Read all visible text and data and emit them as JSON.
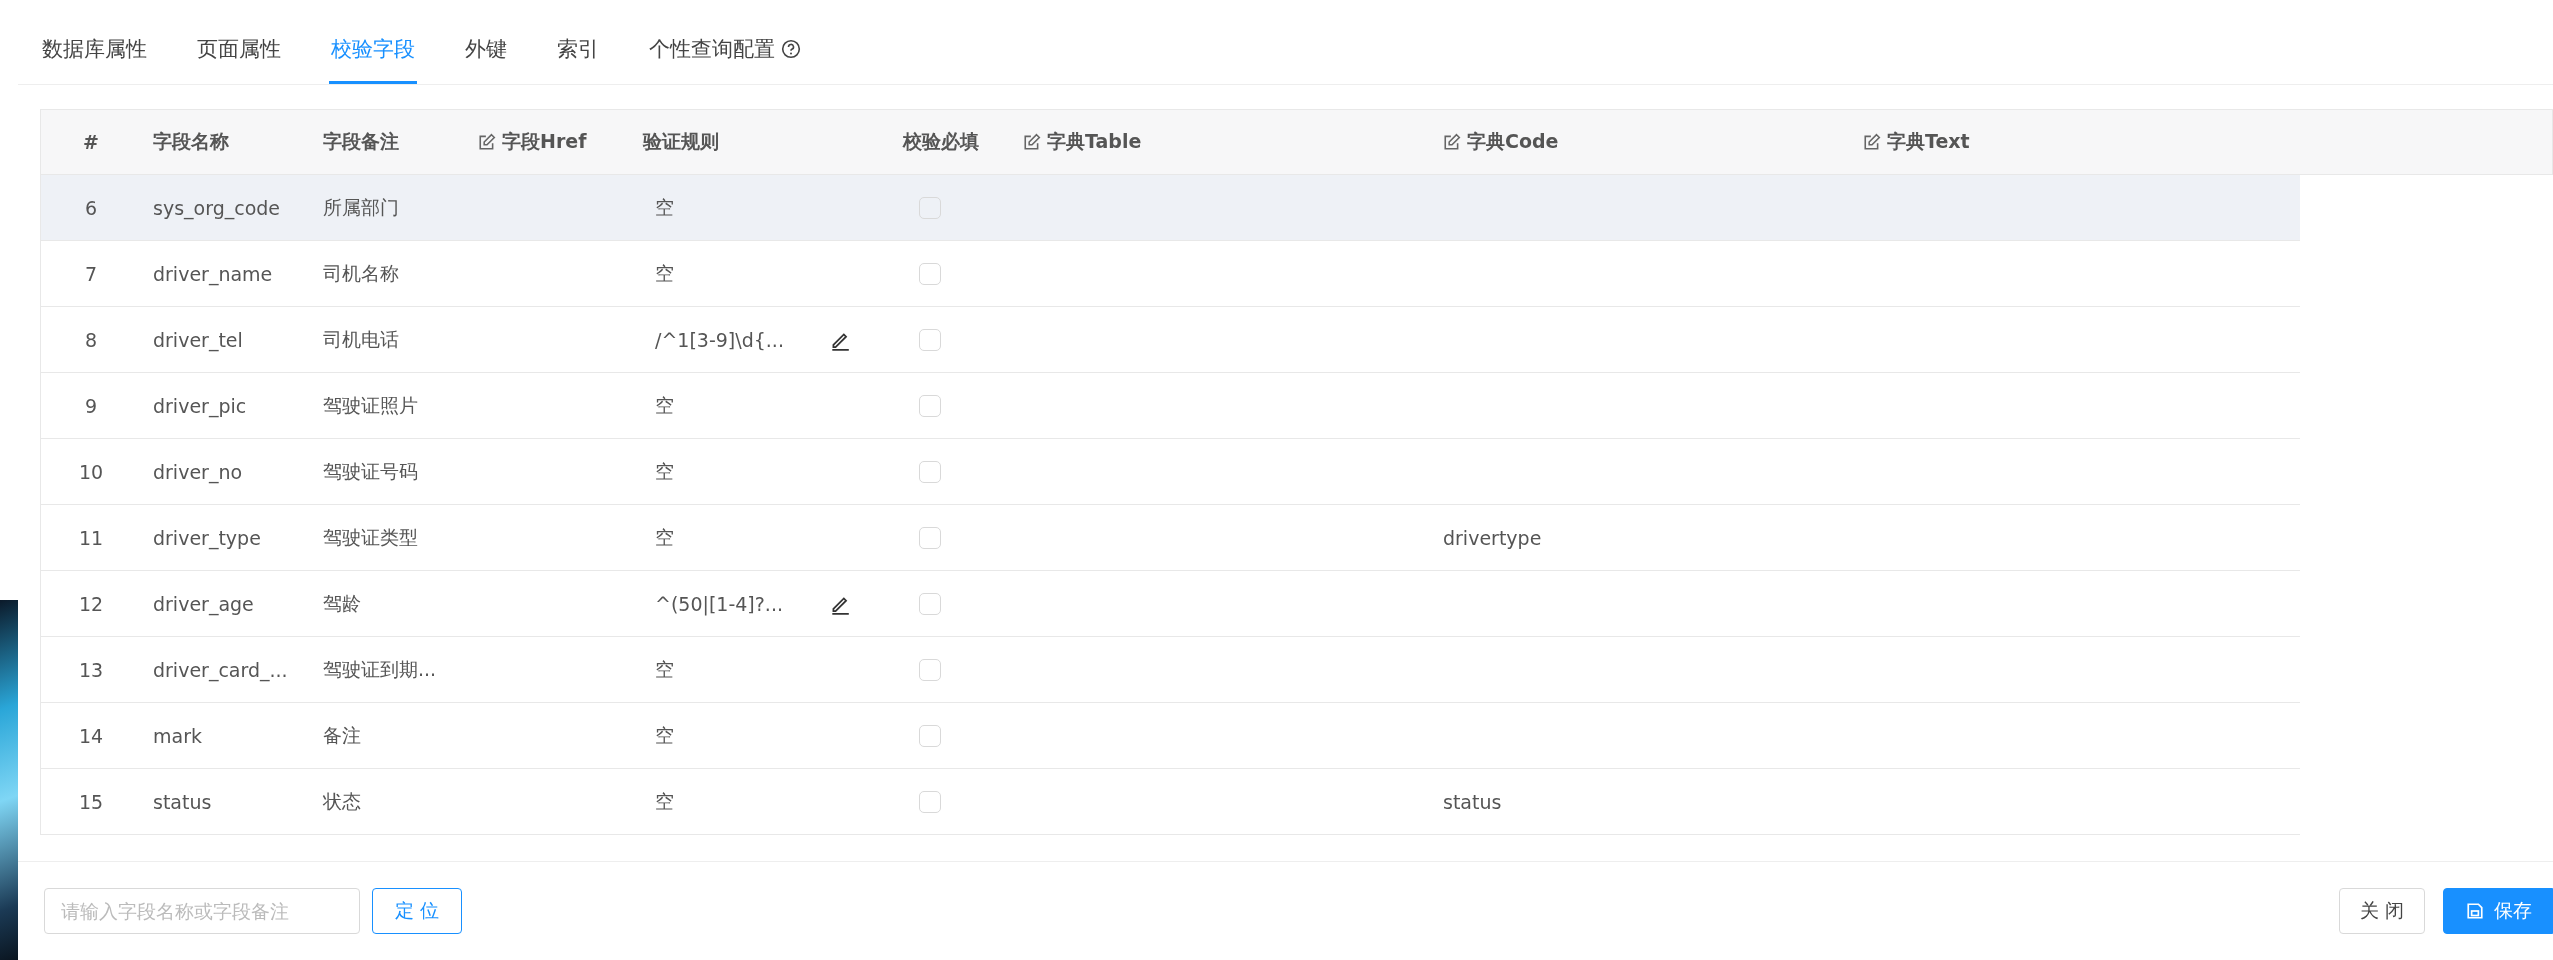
{
  "tabs": [
    {
      "label": "数据库属性",
      "selected": false,
      "help": false
    },
    {
      "label": "页面属性",
      "selected": false,
      "help": false
    },
    {
      "label": "校验字段",
      "selected": true,
      "help": false
    },
    {
      "label": "外键",
      "selected": false,
      "help": false
    },
    {
      "label": "索引",
      "selected": false,
      "help": false
    },
    {
      "label": "个性查询配置",
      "selected": false,
      "help": true
    }
  ],
  "table": {
    "columns": [
      {
        "label": "#",
        "editable": false
      },
      {
        "label": "字段名称",
        "editable": false
      },
      {
        "label": "字段备注",
        "editable": false
      },
      {
        "label": "字段Href",
        "editable": true
      },
      {
        "label": "验证规则",
        "editable": false
      },
      {
        "label": "校验必填",
        "editable": false
      },
      {
        "label": "字典Table",
        "editable": true
      },
      {
        "label": "字典Code",
        "editable": true
      },
      {
        "label": "字典Text",
        "editable": true
      }
    ],
    "rows": [
      {
        "index": "6",
        "name": "sys_org_code",
        "remark": "所属部门",
        "rule": "空",
        "rule_editable": false,
        "required": false,
        "dict_code": "",
        "highlighted": true
      },
      {
        "index": "7",
        "name": "driver_name",
        "remark": "司机名称",
        "rule": "空",
        "rule_editable": false,
        "required": false,
        "dict_code": "",
        "highlighted": false
      },
      {
        "index": "8",
        "name": "driver_tel",
        "remark": "司机电话",
        "rule": "/^1[3-9]\\d{...",
        "rule_editable": true,
        "required": false,
        "dict_code": "",
        "highlighted": false
      },
      {
        "index": "9",
        "name": "driver_pic",
        "remark": "驾驶证照片",
        "rule": "空",
        "rule_editable": false,
        "required": false,
        "dict_code": "",
        "highlighted": false
      },
      {
        "index": "10",
        "name": "driver_no",
        "remark": "驾驶证号码",
        "rule": "空",
        "rule_editable": false,
        "required": false,
        "dict_code": "",
        "highlighted": false
      },
      {
        "index": "11",
        "name": "driver_type",
        "remark": "驾驶证类型",
        "rule": "空",
        "rule_editable": false,
        "required": false,
        "dict_code": "drivertype",
        "highlighted": false
      },
      {
        "index": "12",
        "name": "driver_age",
        "remark": "驾龄",
        "rule": "^(50|[1-4]?...",
        "rule_editable": true,
        "required": false,
        "dict_code": "",
        "highlighted": false
      },
      {
        "index": "13",
        "name": "driver_card_...",
        "remark": "驾驶证到期...",
        "rule": "空",
        "rule_editable": false,
        "required": false,
        "dict_code": "",
        "highlighted": false
      },
      {
        "index": "14",
        "name": "mark",
        "remark": "备注",
        "rule": "空",
        "rule_editable": false,
        "required": false,
        "dict_code": "",
        "highlighted": false
      },
      {
        "index": "15",
        "name": "status",
        "remark": "状态",
        "rule": "空",
        "rule_editable": false,
        "required": false,
        "dict_code": "status",
        "highlighted": false
      }
    ]
  },
  "footer": {
    "search": {
      "placeholder": "请输入字段名称或字段备注"
    },
    "locate_button": "定 位",
    "close_button": "关 闭",
    "save_button": "保存"
  }
}
